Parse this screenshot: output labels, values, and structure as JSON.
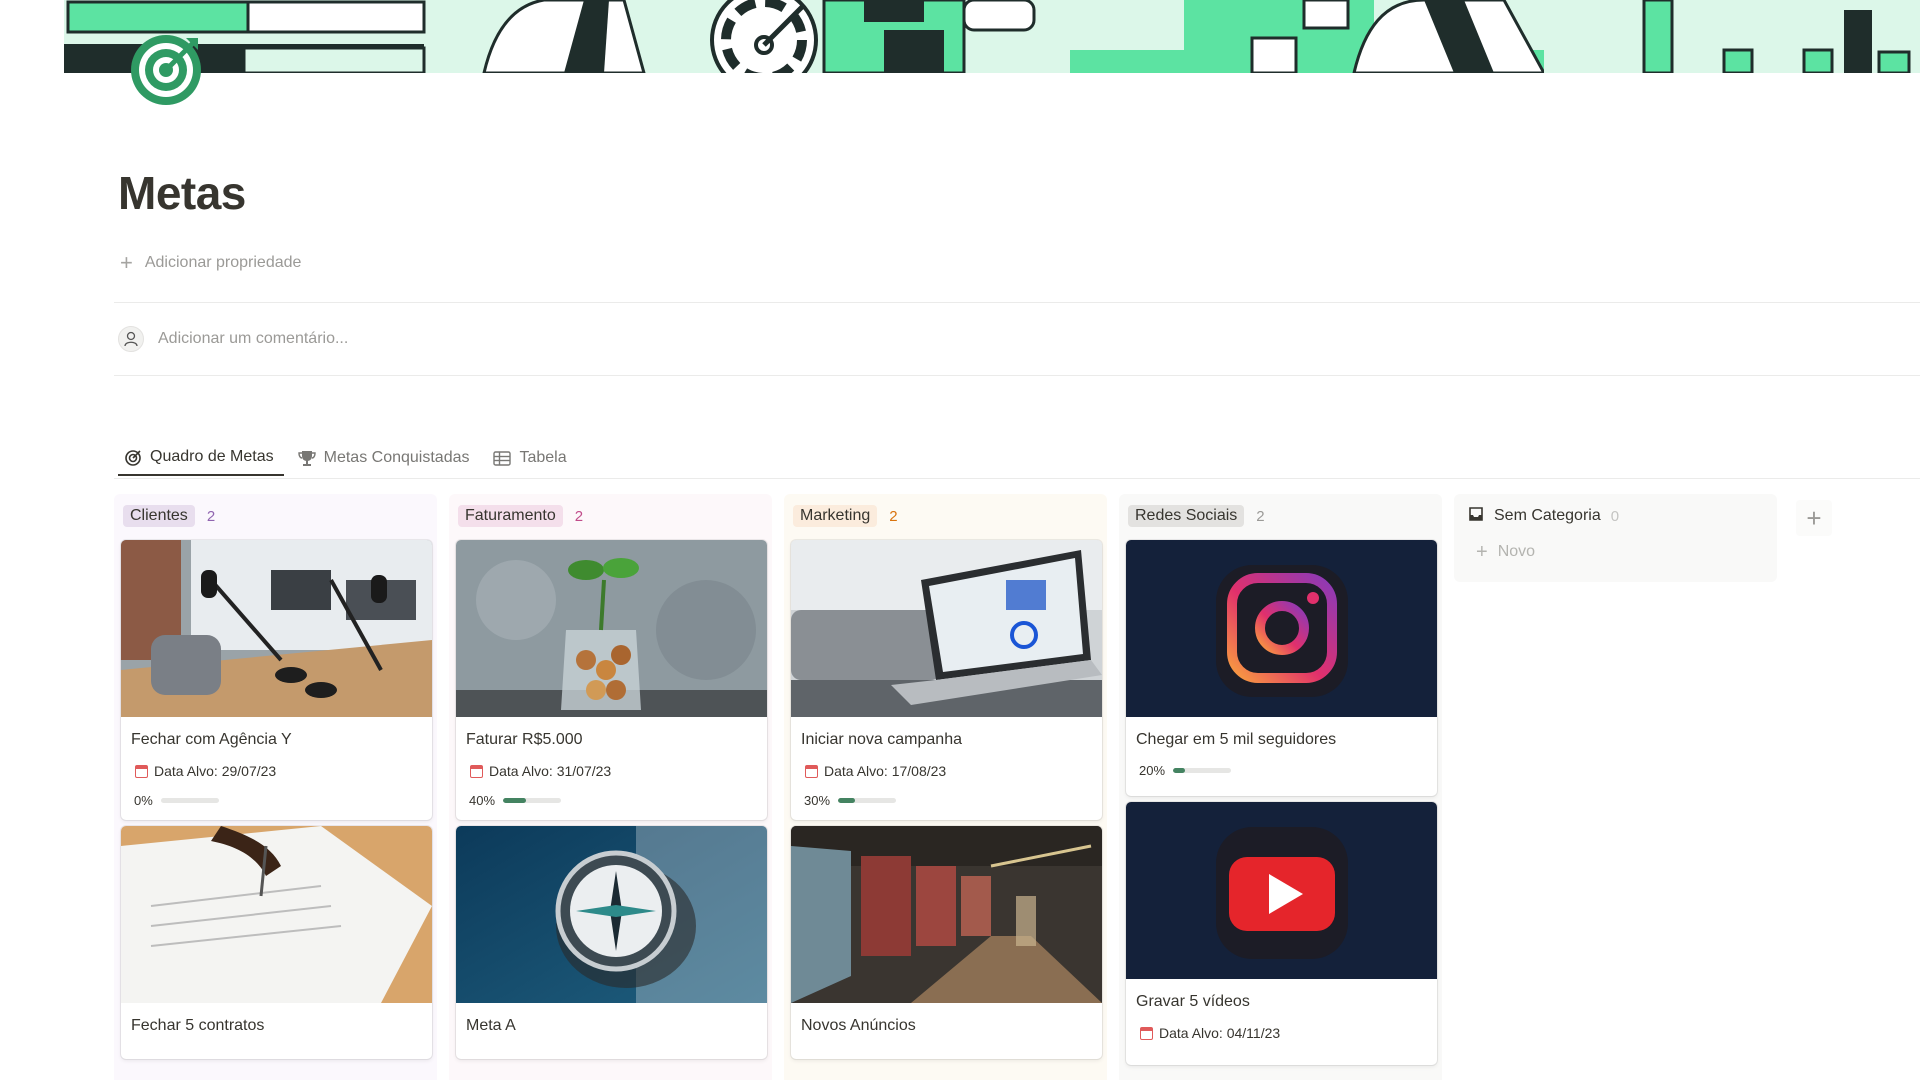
{
  "page": {
    "title": "Metas",
    "add_property_label": "Adicionar propriedade",
    "comment_placeholder": "Adicionar um comentário..."
  },
  "tabs": [
    {
      "label": "Quadro de Metas",
      "icon": "target-icon",
      "active": true
    },
    {
      "label": "Metas Conquistadas",
      "icon": "trophy-icon",
      "active": false
    },
    {
      "label": "Tabela",
      "icon": "table-icon",
      "active": false
    }
  ],
  "columns": [
    {
      "label": "Clientes",
      "count": "2",
      "colors": {
        "bg": "#fbf8fd",
        "tag": "#e8deee",
        "count": "#9065b0"
      },
      "cards": [
        {
          "title": "Fechar com Agência Y",
          "date": "Data Alvo: 29/07/23",
          "progress_label": "0%",
          "progress": 0,
          "image": "podcast-studio"
        },
        {
          "title": "Fechar 5 contratos",
          "image": "signing-document"
        }
      ]
    },
    {
      "label": "Faturamento",
      "count": "2",
      "colors": {
        "bg": "#fdf8fa",
        "tag": "#f4dfeb",
        "count": "#c14c8a"
      },
      "cards": [
        {
          "title": "Faturar R$5.000",
          "date": "Data Alvo: 31/07/23",
          "progress_label": "40%",
          "progress": 40,
          "image": "coins-plant"
        },
        {
          "title": "Meta A",
          "image": "compass"
        }
      ]
    },
    {
      "label": "Marketing",
      "count": "2",
      "colors": {
        "bg": "#fdfaf3",
        "tag": "#fbecdd",
        "count": "#d9730d"
      },
      "cards": [
        {
          "title": "Iniciar nova campanha",
          "date": "Data Alvo: 17/08/23",
          "progress_label": "30%",
          "progress": 30,
          "image": "laptop-dashboard"
        },
        {
          "title": "Novos Anúncios",
          "image": "subway-ads"
        }
      ]
    },
    {
      "label": "Redes Sociais",
      "count": "2",
      "colors": {
        "bg": "#f9f9f8",
        "tag": "#e3e2e0",
        "count": "#9b9a97"
      },
      "cards": [
        {
          "title": "Chegar em 5 mil seguidores",
          "progress_label": "20%",
          "progress": 20,
          "image": "instagram-logo"
        },
        {
          "title": "Gravar 5 vídeos",
          "date": "Data Alvo: 04/11/23",
          "image": "youtube-logo"
        }
      ]
    }
  ],
  "uncategorized": {
    "label": "Sem Categoria",
    "count": "0",
    "new_label": "Novo"
  },
  "accent": "#5ce3a2",
  "dark": "#1f2d2b"
}
